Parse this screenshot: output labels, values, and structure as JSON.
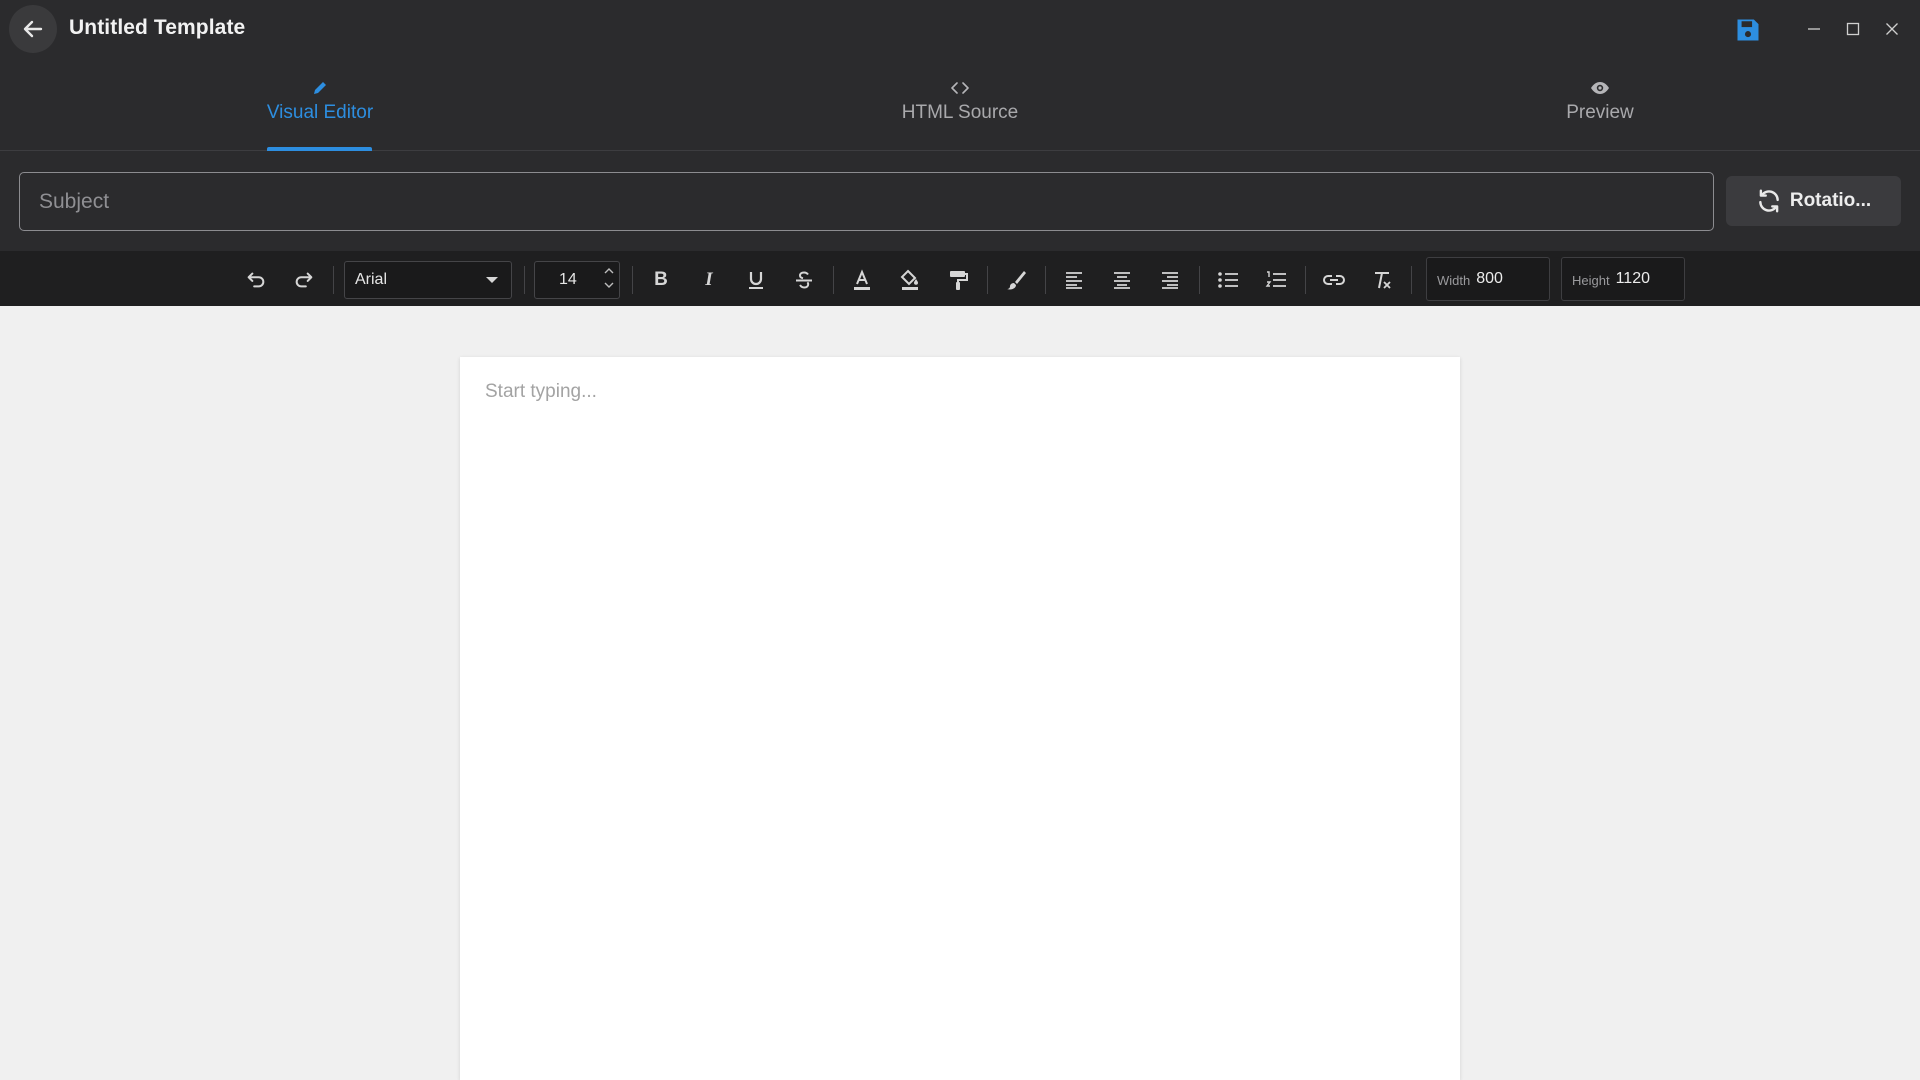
{
  "app": {
    "title": "Untitled Template",
    "accent_color": "#2d8ee0"
  },
  "titlebar": {
    "back_icon": "arrow-left-icon",
    "save_icon": "floppy-disk-icon",
    "window_controls": [
      "minimize-icon",
      "maximize-icon",
      "close-icon"
    ]
  },
  "tabs": [
    {
      "label": "Visual Editor",
      "icon": "pencil-icon",
      "active": true
    },
    {
      "label": "HTML Source",
      "icon": "code-icon",
      "active": false
    },
    {
      "label": "Preview",
      "icon": "eye-icon",
      "active": false
    }
  ],
  "subject": {
    "placeholder": "Subject",
    "value": ""
  },
  "rotation_button": {
    "label": "Rotatio...",
    "icon": "refresh-icon"
  },
  "toolbar": {
    "font_family": "Arial",
    "font_size": "14",
    "width_label": "Width",
    "width_value": "800",
    "height_label": "Height",
    "height_value": "1120",
    "tools": [
      "undo-icon",
      "redo-icon",
      "bold-icon",
      "italic-icon",
      "underline-icon",
      "strikethrough-icon",
      "text-color-icon",
      "highlight-color-icon",
      "format-painter-icon",
      "brush-icon",
      "align-left-icon",
      "align-center-icon",
      "align-right-icon",
      "bullet-list-icon",
      "numbered-list-icon",
      "link-icon",
      "clear-formatting-icon"
    ]
  },
  "editor": {
    "placeholder": "Start typing..."
  }
}
